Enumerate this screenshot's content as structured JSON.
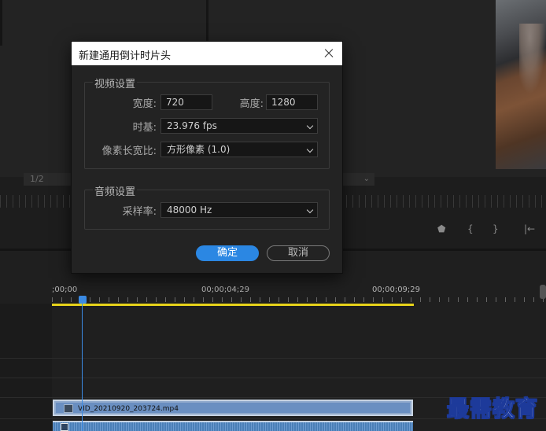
{
  "dialog": {
    "title": "新建通用倒计时片头",
    "video_group": {
      "label": "视频设置",
      "width_label": "宽度:",
      "width_value": "720",
      "height_label": "高度:",
      "height_value": "1280",
      "timebase_label": "时基:",
      "timebase_value": "23.976 fps",
      "pixel_aspect_label": "像素长宽比:",
      "pixel_aspect_value": "方形像素 (1.0)"
    },
    "audio_group": {
      "label": "音频设置",
      "sample_rate_label": "采样率:",
      "sample_rate_value": "48000 Hz"
    },
    "ok_label": "确定",
    "cancel_label": "取消"
  },
  "monitor": {
    "zoom_value": "1/2"
  },
  "timeline": {
    "timecodes": [
      ";00;00",
      "00;00;04;29",
      "00;00;09;29"
    ],
    "clip_name": "VID_20210920_203724.mp4",
    "colors": {
      "playhead": "#3b8be4",
      "work_area": "#e6d21a",
      "video_clip": "#6a8fc1",
      "accent_button": "#2b87e3"
    }
  },
  "watermark": "最需教育"
}
